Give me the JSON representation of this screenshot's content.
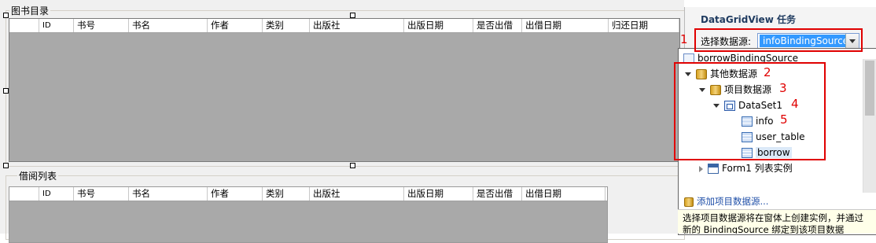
{
  "designer": {
    "groupbox_books": "图书目录",
    "groupbox_borrow": "借阅列表",
    "book_columns": [
      "",
      "ID",
      "书号",
      "书名",
      "作者",
      "类别",
      "出版社",
      "出版日期",
      "是否出借",
      "出借日期",
      "归还日期"
    ],
    "borrow_columns": [
      "",
      "ID",
      "书号",
      "书名",
      "作者",
      "类别",
      "出版社",
      "出版日期",
      "是否出借",
      "出借日期"
    ]
  },
  "smart_tag": {
    "title": "DataGridView 任务",
    "datasource_label": "选择数据源:",
    "datasource_value": "infoBindingSource"
  },
  "dropdown": {
    "top_item": "borrowBindingSource",
    "other_sources": "其他数据源",
    "project_sources": "项目数据源",
    "dataset": "DataSet1",
    "tables": [
      "info",
      "user_table",
      "borrow"
    ],
    "form_instances": "Form1 列表实例",
    "add_link": "添加项目数据源...",
    "description": "选择项目数据源将在窗体上创建实例，并通过新的 BindingSource 绑定到该项目数据"
  },
  "annotations": [
    "1",
    "2",
    "3",
    "4",
    "5"
  ],
  "colors": {
    "annotation": "#e00000",
    "selection": "#3399ff",
    "grid_bg": "#a9a9a9"
  }
}
